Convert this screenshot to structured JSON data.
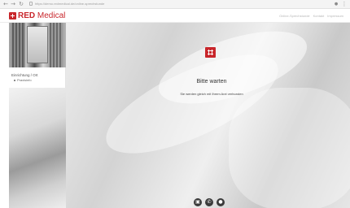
{
  "browser": {
    "url": "https://demo.redmedical.de/online-sprechstunde",
    "back_glyph": "←",
    "forward_glyph": "→",
    "reload_glyph": "↻",
    "ext_glyph": "●",
    "menu_glyph": "⋮"
  },
  "header": {
    "logo_brand": "RED",
    "logo_suffix": " Medical",
    "links": [
      "Online-Sprechstunde",
      "Kontakt",
      "Impressum"
    ]
  },
  "sidebar": {
    "title": "Einrichtung / Ort",
    "items": [
      "Praxisinfo"
    ]
  },
  "main": {
    "wait_title": "Bitte warten",
    "wait_subtitle": "Sie werden gleich mit Ihrem Arzt verbunden"
  },
  "controls": {
    "camera_glyph": "▣",
    "phone_glyph": "✆",
    "mic_glyph": "●"
  },
  "colors": {
    "brand_red": "#c8262b"
  }
}
